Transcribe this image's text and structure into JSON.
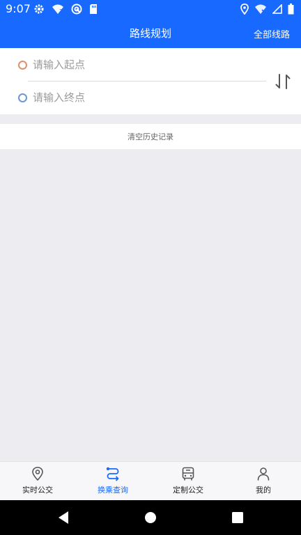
{
  "status_bar": {
    "time": "9:07",
    "icons": [
      "gear-icon",
      "wifi-question-icon",
      "cast-icon",
      "sd-card-icon",
      "location-icon",
      "wifi-x-icon",
      "signal-icon",
      "battery-icon"
    ]
  },
  "app_bar": {
    "title": "路线规划",
    "action": "全部线路"
  },
  "route": {
    "start_placeholder": "请输入起点",
    "end_placeholder": "请输入终点",
    "start_value": "",
    "end_value": ""
  },
  "history": {
    "clear_label": "清空历史记录"
  },
  "bottom_nav": {
    "items": [
      {
        "label": "实时公交",
        "icon": "location-pin-icon"
      },
      {
        "label": "换乘查询",
        "icon": "route-icon",
        "active": true
      },
      {
        "label": "定制公交",
        "icon": "bus-icon"
      },
      {
        "label": "我的",
        "icon": "person-icon"
      }
    ]
  },
  "colors": {
    "primary": "#1769FF",
    "start_dot": "#E0906A",
    "end_dot": "#6E95D6",
    "background": "#ECECF1"
  }
}
